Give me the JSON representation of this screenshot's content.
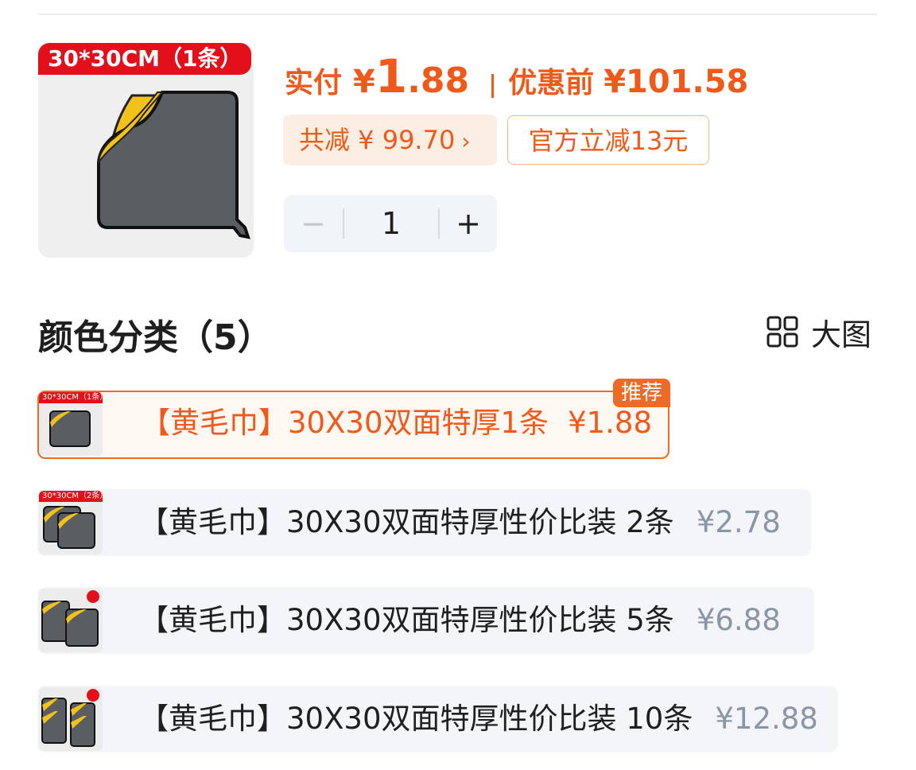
{
  "product": {
    "thumb_tag": "30*30CM（1条）"
  },
  "price": {
    "paid_label": "实付",
    "yen": "¥",
    "int": "1",
    "dec": ".88",
    "orig_label": "优惠前",
    "orig_price": "¥101.58"
  },
  "discounts": {
    "total": "共减 ¥ 99.70",
    "total_arrow": "›",
    "official": "官方立减13元"
  },
  "stepper": {
    "minus": "−",
    "quantity": "1",
    "plus": "+"
  },
  "section": {
    "title": "颜色分类（5）",
    "bigview_label": "大图",
    "bigview_icon": "grid-icon"
  },
  "options": [
    {
      "tag": "30*30CM（1条）",
      "label": "【黄毛巾】30X30双面特厚1条",
      "price": "¥1.88",
      "badge": "推荐",
      "selected": true
    },
    {
      "tag": "30*30CM（2条）",
      "label": "【黄毛巾】30X30双面特厚性价比装 2条",
      "price": "¥2.78",
      "selected": false
    },
    {
      "label": "【黄毛巾】30X30双面特厚性价比装 5条",
      "price": "¥6.88",
      "selected": false
    },
    {
      "label": "【黄毛巾】30X30双面特厚性价比装 10条",
      "price": "¥12.88",
      "selected": false
    }
  ],
  "colors": {
    "accent": "#ef5a1a",
    "tag_red": "#e3101c",
    "towel_gray": "#5a5e63",
    "towel_yellow": "#f2c21a"
  }
}
